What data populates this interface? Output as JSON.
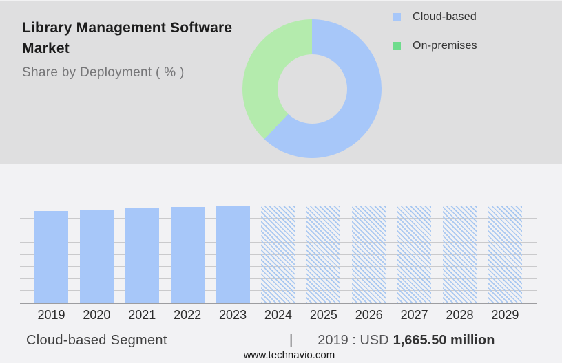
{
  "header": {
    "title": "Library Management Software Market",
    "subtitle": "Share by Deployment ( % )"
  },
  "legend": {
    "items": [
      {
        "label": "Cloud-based",
        "color": "#a7c7f9"
      },
      {
        "label": "On-premises",
        "color": "#6edc8c"
      }
    ]
  },
  "chart_data": [
    {
      "type": "pie",
      "donut": true,
      "title": "Share by Deployment ( % )",
      "slices": [
        {
          "label": "Cloud-based",
          "value": 62,
          "color": "#a7c7f9"
        },
        {
          "label": "On-premises",
          "value": 38,
          "color": "#b4ebad"
        }
      ],
      "value_labels_shown": false,
      "legend_position": "right"
    },
    {
      "type": "bar",
      "categories": [
        "2019",
        "2020",
        "2021",
        "2022",
        "2023",
        "2024",
        "2025",
        "2026",
        "2027",
        "2028",
        "2029"
      ],
      "values": [
        95.4,
        96.8,
        98.4,
        99.3,
        100,
        100,
        100,
        100,
        100,
        100,
        100
      ],
      "forecast": [
        false,
        false,
        false,
        false,
        false,
        true,
        true,
        true,
        true,
        true,
        true
      ],
      "ylim": [
        0,
        100
      ],
      "grid": true,
      "gridline_count": 9,
      "xlabel": "",
      "ylabel": "",
      "bar_color": "#a7c7f9",
      "forecast_style": "diagonal-hatch"
    }
  ],
  "footer": {
    "segment_label": "Cloud-based Segment",
    "divider": "|",
    "value_prefix": "2019 : USD",
    "value_bold": "1,665.50 million",
    "website": "www.technavio.com"
  },
  "colors": {
    "top_panel_bg": "#dfdfe0",
    "bottom_panel_bg": "#f2f2f4",
    "gridline": "#cacacc",
    "axis": "#9d9da0"
  }
}
